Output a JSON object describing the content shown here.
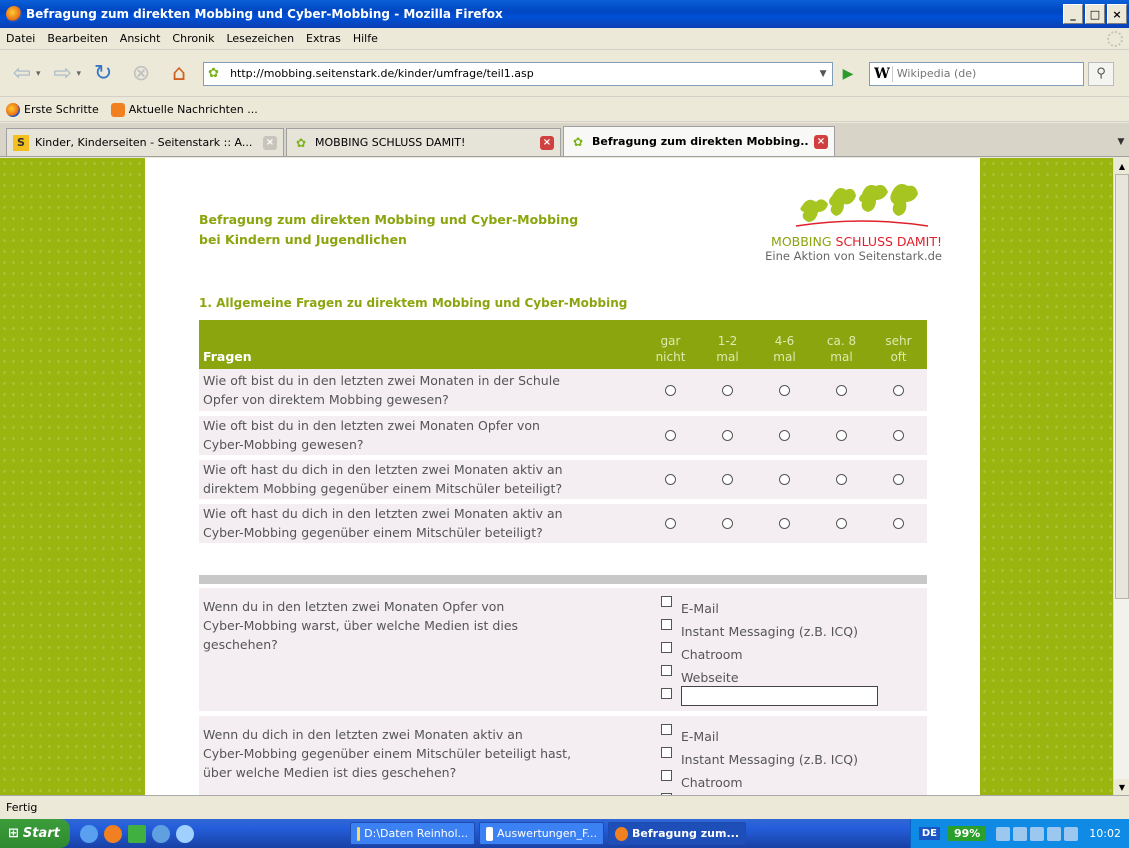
{
  "window": {
    "title": "Befragung zum direkten Mobbing und Cyber-Mobbing - Mozilla Firefox",
    "buttons": {
      "minimize": "_",
      "maximize": "□",
      "close": "×"
    }
  },
  "menu": [
    "Datei",
    "Bearbeiten",
    "Ansicht",
    "Chronik",
    "Lesezeichen",
    "Extras",
    "Hilfe"
  ],
  "nav": {
    "url": "http://mobbing.seitenstark.de/kinder/umfrage/teil1.asp",
    "search_engine_icon": "W",
    "search_placeholder": "Wikipedia (de)"
  },
  "bookmarks": [
    "Erste Schritte",
    "Aktuelle Nachrichten ..."
  ],
  "tabs": [
    {
      "label": "Kinder, Kinderseiten - Seitenstark :: A...",
      "icon": "S"
    },
    {
      "label": "MOBBING SCHLUSS DAMIT!",
      "icon": "puzzle"
    },
    {
      "label": "Befragung zum direkten Mobbing...",
      "icon": "puzzle",
      "active": true
    }
  ],
  "page": {
    "title_line1": "Befragung zum direkten Mobbing und Cyber-Mobbing",
    "title_line2": "bei Kindern und Jugendlichen",
    "logo_line1_green": "MOBBING ",
    "logo_line1_red": "SCHLUSS DAMIT!",
    "logo_line2": "Eine Aktion von Seitenstark.de",
    "section_title": "1. Allgemeine Fragen zu direktem Mobbing und Cyber-Mobbing",
    "table": {
      "header_question": "Fragen",
      "columns": [
        {
          "l1": "gar",
          "l2": "nicht"
        },
        {
          "l1": "1-2",
          "l2": "mal"
        },
        {
          "l1": "4-6",
          "l2": "mal"
        },
        {
          "l1": "ca. 8",
          "l2": "mal"
        },
        {
          "l1": "sehr",
          "l2": "oft"
        }
      ],
      "rows": [
        {
          "l1": "Wie oft bist du in den letzten zwei Monaten in der Schule",
          "l2": "Opfer von direktem Mobbing gewesen?"
        },
        {
          "l1": "Wie oft bist du in den letzten zwei Monaten Opfer von",
          "l2": "Cyber-Mobbing gewesen?"
        },
        {
          "l1": "Wie oft hast du dich in den letzten zwei Monaten aktiv an",
          "l2": "direktem Mobbing gegenüber einem Mitschüler beteiligt?"
        },
        {
          "l1": "Wie oft hast du dich in den letzten zwei Monaten aktiv an",
          "l2": "Cyber-Mobbing gegenüber einem Mitschüler beteiligt?"
        }
      ]
    },
    "media_q1": {
      "l1": "Wenn du in den letzten zwei Monaten Opfer von",
      "l2": "Cyber-Mobbing warst, über welche Medien ist dies",
      "l3": "geschehen?",
      "options": [
        "E-Mail",
        "Instant Messaging (z.B. ICQ)",
        "Chatroom",
        "Webseite"
      ],
      "other_value": ""
    },
    "media_q2": {
      "l1": "Wenn du dich in den letzten zwei Monaten aktiv an",
      "l2": "Cyber-Mobbing gegenüber einem Mitschüler beteiligt hast,",
      "l3": "über welche Medien ist dies geschehen?",
      "options": [
        "E-Mail",
        "Instant Messaging (z.B. ICQ)",
        "Chatroom"
      ]
    }
  },
  "status": "Fertig",
  "taskbar": {
    "start": "Start",
    "buttons": [
      {
        "label": "D:\\Daten Reinhol..."
      },
      {
        "label": "Auswertungen_F..."
      },
      {
        "label": "Befragung zum...",
        "active": true
      }
    ],
    "lang": "DE",
    "battery": "99%",
    "clock": "10:02"
  },
  "colors": {
    "accent_green": "#8aa50e",
    "logo_red": "#e0202a",
    "row_bg": "#f4eef2",
    "side_bg": "#9bb510"
  }
}
